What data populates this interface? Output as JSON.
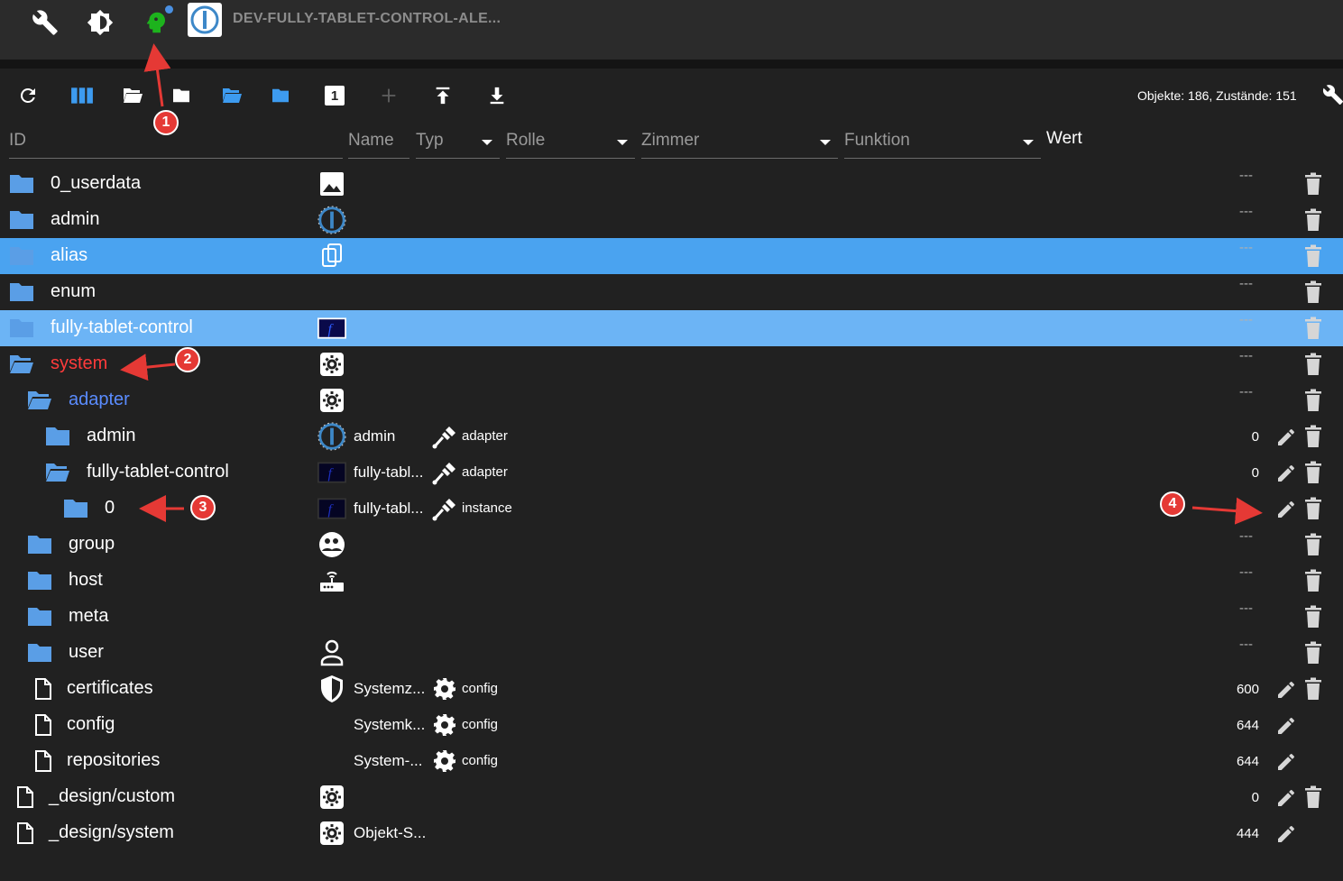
{
  "app": {
    "title": "DEV-FULLY-TABLET-CONTROL-ALE...",
    "icons": [
      "wrench-icon",
      "gear-icon",
      "robot-head-icon",
      "iobroker-logo"
    ]
  },
  "toolbar": {
    "buttons": [
      "refresh-icon",
      "columns-icon",
      "folder-open-icon",
      "folder-icon",
      "folder-open-blue-icon",
      "folder-blue-icon",
      "counter-icon",
      "add-icon",
      "upload-icon",
      "download-icon"
    ],
    "counter_label": "1",
    "stats": "Objekte: 186, Zustände: 151"
  },
  "columns": {
    "id": "ID",
    "name": "Name",
    "typ": "Typ",
    "rolle": "Rolle",
    "zimmer": "Zimmer",
    "funktion": "Funktion",
    "wert": "Wert"
  },
  "rows": [
    {
      "id": "0_userdata",
      "name": "",
      "role": "",
      "value": "---",
      "icon": "image-icon"
    },
    {
      "id": "admin",
      "name": "",
      "role": "",
      "value": "---",
      "icon": "iobroker-icon"
    },
    {
      "id": "alias",
      "name": "",
      "role": "",
      "value": "---",
      "icon": "copy-icon"
    },
    {
      "id": "enum",
      "name": "",
      "role": "",
      "value": "---",
      "icon": ""
    },
    {
      "id": "fully-tablet-control",
      "name": "",
      "role": "",
      "value": "---",
      "icon": "fully-icon"
    },
    {
      "id": "system",
      "name": "",
      "role": "",
      "value": "---",
      "icon": "settings-icon"
    },
    {
      "id": "adapter",
      "name": "",
      "role": "",
      "value": "---",
      "icon": "settings-icon"
    },
    {
      "id": "admin",
      "name": "admin",
      "role": "adapter",
      "value": "0",
      "icon": "iobroker-icon"
    },
    {
      "id": "fully-tablet-control",
      "name": "fully-tabl...",
      "role": "adapter",
      "value": "0",
      "icon": "fully-icon"
    },
    {
      "id": "0",
      "name": "fully-tabl...",
      "role": "instance",
      "value": "",
      "icon": "fully-icon"
    },
    {
      "id": "group",
      "name": "",
      "role": "",
      "value": "---",
      "icon": "group-icon"
    },
    {
      "id": "host",
      "name": "",
      "role": "",
      "value": "---",
      "icon": "router-icon"
    },
    {
      "id": "meta",
      "name": "",
      "role": "",
      "value": "---",
      "icon": ""
    },
    {
      "id": "user",
      "name": "",
      "role": "",
      "value": "---",
      "icon": "user-icon"
    },
    {
      "id": "certificates",
      "name": "Systemz...",
      "role": "config",
      "value": "600",
      "icon": "shield-icon"
    },
    {
      "id": "config",
      "name": "Systemk...",
      "role": "config",
      "value": "644",
      "icon": ""
    },
    {
      "id": "repositories",
      "name": "System-...",
      "role": "config",
      "value": "644",
      "icon": ""
    },
    {
      "id": "_design/custom",
      "name": "",
      "role": "",
      "value": "0",
      "icon": "settings-icon"
    },
    {
      "id": "_design/system",
      "name": "Objekt-S...",
      "role": "",
      "value": "444",
      "icon": "settings-icon"
    }
  ],
  "annotations": [
    "1",
    "2",
    "3",
    "4"
  ],
  "colors": {
    "background": "#212121",
    "topbar": "#2b2b2b",
    "selected_row": "#4aa3f0",
    "selected_row_light": "#6cb4f5",
    "folder": "#5a9ee6",
    "highlight_red": "#ff3b3b",
    "highlight_blue": "#5a8cff",
    "annotation": "#e53935"
  }
}
